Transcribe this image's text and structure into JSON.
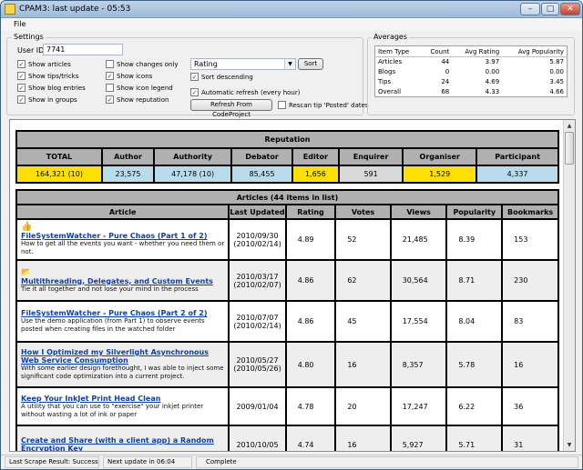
{
  "window": {
    "title": "CPAM3: last update - 05:53",
    "minimize": "–",
    "maximize": "□",
    "close": "✕"
  },
  "menu": {
    "file": "File"
  },
  "settings": {
    "group_label": "Settings",
    "user_id_label": "User ID",
    "user_id_value": "7741",
    "show_articles": "Show articles",
    "show_tips": "Show tips/tricks",
    "show_blog": "Show blog entries",
    "show_groups": "Show in groups",
    "show_changes": "Show changes only",
    "show_icons": "Show icons",
    "show_icon_legend": "Show icon legend",
    "show_reputation": "Show reputation",
    "sort_select": "Rating",
    "sort_button": "Sort",
    "sort_desc": "Sort descending",
    "auto_refresh": "Automatic refresh (every hour)",
    "refresh_button": "Refresh From CodeProject",
    "rescan_tip": "Rescan tip 'Posted' dates"
  },
  "averages": {
    "group_label": "Averages",
    "headers": [
      "Item Type",
      "Count",
      "Avg Rating",
      "Avg Popularity"
    ],
    "rows": [
      [
        "Articles",
        "44",
        "3.97",
        "5.87"
      ],
      [
        "Blogs",
        "0",
        "0.00",
        "0.00"
      ],
      [
        "Tips",
        "24",
        "4.69",
        "3.45"
      ],
      [
        "Overall",
        "68",
        "4.33",
        "4.66"
      ]
    ]
  },
  "reputation": {
    "title": "Reputation",
    "headers": [
      "TOTAL",
      "Author",
      "Authority",
      "Debator",
      "Editor",
      "Enquirer",
      "Organiser",
      "Participant"
    ],
    "values": [
      "164,321 (10)",
      "23,575",
      "47,178 (10)",
      "85,455",
      "1,656",
      "591",
      "1,529",
      "4,337"
    ]
  },
  "articles": {
    "title": "Articles (44 items in list)",
    "headers": [
      "Article",
      "Last Updated",
      "Rating",
      "Votes",
      "Views",
      "Popularity",
      "Bookmarks"
    ],
    "rows": [
      {
        "title": "FileSystemWatcher - Pure Chaos (Part 1 of 2)",
        "desc": "How to get all the events you want - whether you need them or not.",
        "updated": "2010/09/30",
        "updated2": "(2010/02/14)",
        "rating": "4.89",
        "votes": "52",
        "views": "21,485",
        "popularity": "8.39",
        "bookmarks": "153",
        "icon": "thumbs-up-icon"
      },
      {
        "title": "Multithreading, Delegates, and Custom Events",
        "desc": "Tie it all together and not lose your mind in the process",
        "updated": "2010/03/17",
        "updated2": "(2010/02/07)",
        "rating": "4.86",
        "votes": "62",
        "views": "30,564",
        "popularity": "8.71",
        "bookmarks": "230",
        "icon": "folder-icon"
      },
      {
        "title": "FileSystemWatcher - Pure Chaos (Part 2 of 2)",
        "desc": "Use the demo application (from Part 1) to observe events posted when creating files in the watched folder",
        "updated": "2010/07/07",
        "updated2": "(2010/02/14)",
        "rating": "4.86",
        "votes": "45",
        "views": "17,554",
        "popularity": "8.04",
        "bookmarks": "83",
        "icon": ""
      },
      {
        "title": "How I Optimized my Silverlight Asynchronous Web Service Consumption",
        "desc": "With some earlier design forethought, I was able to inject some significant code optimization into a current project.",
        "updated": "2010/05/27",
        "updated2": "(2010/05/26)",
        "rating": "4.80",
        "votes": "16",
        "views": "8,357",
        "popularity": "5.78",
        "bookmarks": "16",
        "icon": ""
      },
      {
        "title": "Keep Your InkJet Print Head Clean",
        "desc": "A utility that you can use to \"exercise\" your inkjet printer without wasting a lot of ink or paper",
        "updated": "2009/01/04",
        "updated2": "",
        "rating": "4.78",
        "votes": "20",
        "views": "17,247",
        "popularity": "6.22",
        "bookmarks": "36",
        "icon": ""
      },
      {
        "title": "Create and Share (with a client app) a Random Encryption Key",
        "desc": "",
        "updated": "2010/10/05",
        "updated2": "",
        "rating": "4.74",
        "votes": "16",
        "views": "5,927",
        "popularity": "5.71",
        "bookmarks": "31",
        "icon": ""
      }
    ]
  },
  "status": {
    "scrape": "Last Scrape Result: Success",
    "next_update": "Next update in 06:04",
    "state": "Complete"
  },
  "colors": {
    "yellow": "#ffdf00",
    "light_blue": "#b8dcec",
    "header_gray": "#b0b0b0",
    "link": "#0a3fb0"
  }
}
